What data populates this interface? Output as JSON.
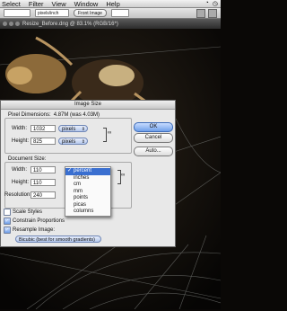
{
  "menubar": {
    "items": [
      "Select",
      "Filter",
      "View",
      "Window",
      "Help"
    ]
  },
  "optionbar": {
    "field_value": "pixels/inch",
    "button": "Front Image"
  },
  "document": {
    "title": "Resize_Before.dng @ 83.1% (RGB/16*)"
  },
  "dialog": {
    "title": "Image Size",
    "pixel_dimensions": {
      "label": "Pixel Dimensions:",
      "value": "4.87M (was 4.03M)",
      "width_label": "Width:",
      "width_value": "1032",
      "width_unit": "pixels",
      "height_label": "Height:",
      "height_value": "825",
      "height_unit": "pixels"
    },
    "document_size": {
      "label": "Document Size:",
      "width_label": "Width:",
      "width_value": "110",
      "width_unit": "percent",
      "height_label": "Height:",
      "height_value": "110",
      "resolution_label": "Resolution:",
      "resolution_value": "240"
    },
    "buttons": {
      "ok": "OK",
      "cancel": "Cancel",
      "auto": "Auto..."
    },
    "checkboxes": {
      "scale_styles": "Scale Styles",
      "constrain_proportions": "Constrain Proportions",
      "resample_image": "Resample Image:"
    },
    "resample_method": "Bicubic (best for smooth gradients)",
    "unit_menu": [
      "percent",
      "inches",
      "cm",
      "mm",
      "points",
      "picas",
      "columns"
    ]
  },
  "colors": {
    "dialog_bg": "#e8e8e8",
    "select_blue": "#3a6fd0",
    "canvas_bg": "#0a0806"
  }
}
